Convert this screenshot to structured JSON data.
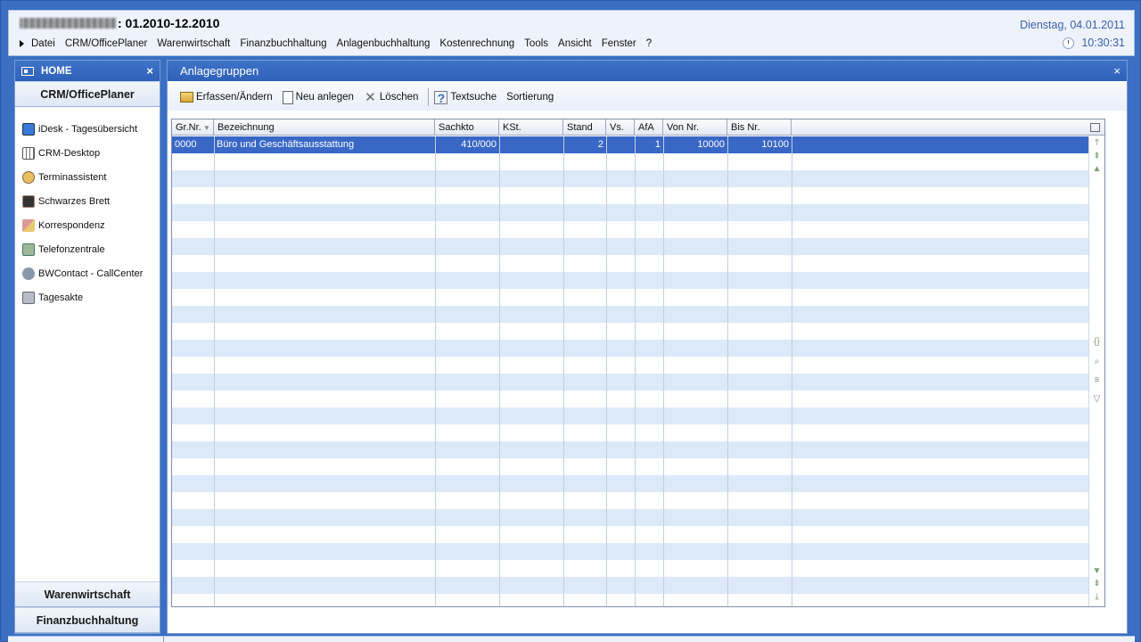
{
  "header": {
    "period": ": 01.2010-12.2010",
    "date": "Dienstag, 04.01.2011",
    "time": "10:30:31",
    "menu": [
      "Datei",
      "CRM/OfficePlaner",
      "Warenwirtschaft",
      "Finanzbuchhaltung",
      "Anlagenbuchhaltung",
      "Kostenrechnung",
      "Tools",
      "Ansicht",
      "Fenster",
      "?"
    ]
  },
  "sidebar": {
    "title": "HOME",
    "close": "×",
    "section": "CRM/OfficePlaner",
    "items": [
      {
        "label": "iDesk - Tagesübersicht",
        "icon": "monitor-icon"
      },
      {
        "label": "CRM-Desktop",
        "icon": "calendar-icon"
      },
      {
        "label": "Terminassistent",
        "icon": "wizard-icon"
      },
      {
        "label": "Schwarzes Brett",
        "icon": "board-icon"
      },
      {
        "label": "Korrespondenz",
        "icon": "person-mail-icon"
      },
      {
        "label": "Telefonzentrale",
        "icon": "phone-icon"
      },
      {
        "label": "BWContact - CallCenter",
        "icon": "headset-icon"
      },
      {
        "label": "Tagesakte",
        "icon": "folder-icon"
      }
    ],
    "bottom_sections": [
      "Warenwirtschaft",
      "Finanzbuchhaltung"
    ]
  },
  "main": {
    "title": "Anlagegruppen",
    "close": "×",
    "toolbar": {
      "edit": "Erfassen/Ändern",
      "new": "Neu anlegen",
      "delete": "Löschen",
      "search": "Textsuche",
      "sort": "Sortierung"
    },
    "grid": {
      "columns": [
        "Gr.Nr.",
        "Bezeichnung",
        "Sachkto",
        "KSt.",
        "Stand",
        "Vs.",
        "AfA",
        "Von Nr.",
        "Bis Nr."
      ],
      "rows": [
        {
          "grnr": "0000",
          "bezeichnung": "Büro und Geschäftsausstattung",
          "sachkto": "410/000",
          "kst": "",
          "stand": "2",
          "vs": "",
          "afa": "1",
          "von": "10000",
          "bis": "10100"
        }
      ]
    }
  },
  "colors": {
    "accent": "#3967c6",
    "row_alt": "#dce9f8",
    "header_blue": "#3c5fa8"
  }
}
